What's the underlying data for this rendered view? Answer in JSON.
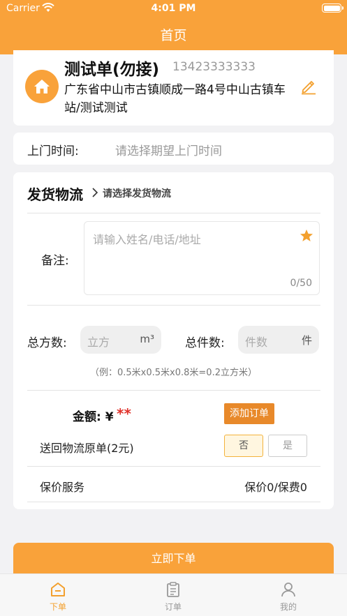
{
  "status_bar": {
    "carrier": "Carrier",
    "time": "4:01 PM"
  },
  "nav": {
    "title": "首页"
  },
  "address": {
    "name": "测试单(勿接)",
    "phone": "13423333333",
    "text": "广东省中山市古镇顺成一路4号中山古镇车站/测试测试"
  },
  "visit_time": {
    "label": "上门时间:",
    "placeholder": "请选择期望上门时间"
  },
  "logistics": {
    "title": "发货物流",
    "hint": "请选择发货物流"
  },
  "note": {
    "label": "备注:",
    "placeholder": "请输入姓名/电话/地址",
    "count": "0/50"
  },
  "volume": {
    "label": "总方数:",
    "placeholder": "立方",
    "unit": "m³"
  },
  "pieces": {
    "label": "总件数:",
    "placeholder": "件数",
    "unit": "件"
  },
  "example": "（例：0.5米x0.5米x0.8米=0.2立方米）",
  "amount": {
    "label": "金额: ¥",
    "value": "**",
    "add_button": "添加订单"
  },
  "return_doc": {
    "label": "送回物流原单(2元)",
    "no": "否",
    "yes": "是"
  },
  "insurance": {
    "label": "保价服务",
    "value": "保价0/保费0"
  },
  "submit": "立即下单",
  "tabs": [
    {
      "label": "下单",
      "active": true
    },
    {
      "label": "订单",
      "active": false
    },
    {
      "label": "我的",
      "active": false
    }
  ],
  "colors": {
    "primary": "#f9a23a",
    "accent_button": "#e8892a",
    "price": "#e0322b"
  }
}
